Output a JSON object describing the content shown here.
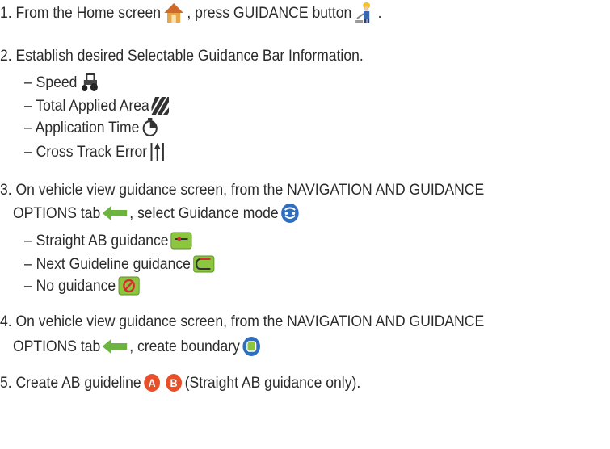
{
  "steps": [
    {
      "part1": "1. From the Home screen ",
      "part2": ", press GUIDANCE button ",
      "part3": "."
    },
    {
      "text": "2. Establish desired Selectable Guidance Bar Information."
    },
    {
      "text": "3. On vehicle view guidance screen, from the NAVIGATION AND GUIDANCE"
    },
    {
      "text": "4. On vehicle view guidance screen, from the NAVIGATION AND GUIDANCE"
    },
    {
      "part1": "5. Create AB guideline ",
      "part2": " (Straight AB guidance only)."
    }
  ],
  "step2_items": [
    "– Speed",
    "– Total Applied Area",
    "– Application Time",
    "– Cross Track Error"
  ],
  "step3": {
    "cont1": "OPTIONS tab ",
    "cont2": ", select Guidance mode"
  },
  "step3_items": [
    "– Straight AB guidance",
    "– Next Guideline guidance",
    "– No guidance"
  ],
  "step4": {
    "cont1": "OPTIONS tab ",
    "cont2": ", create boundary"
  },
  "icons": {
    "home": "home-icon",
    "guidance": "guidance-worker-icon",
    "speed": "tractor-icon",
    "area": "hatched-area-icon",
    "time": "stopwatch-icon",
    "xte": "cross-track-error-icon",
    "tab": "green-arrow-tab-icon",
    "mode": "guidance-mode-icon",
    "straight": "straight-ab-icon",
    "next": "next-guideline-icon",
    "none": "no-guidance-icon",
    "boundary": "boundary-icon",
    "a": "point-a-icon",
    "b": "point-b-icon"
  }
}
